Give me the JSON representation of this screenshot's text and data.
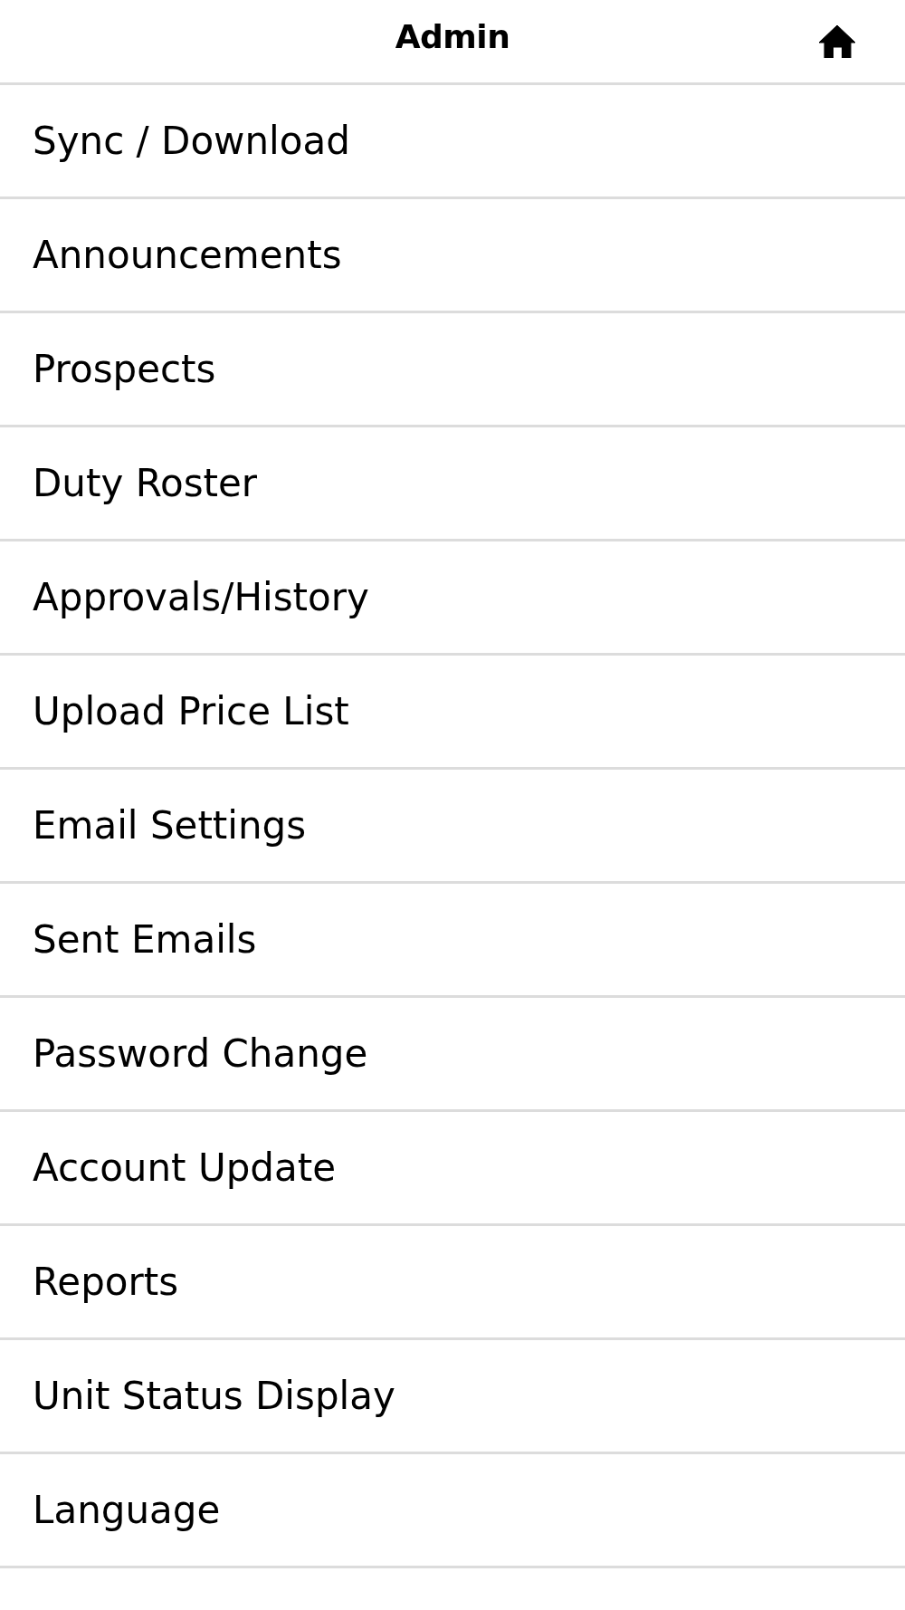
{
  "header": {
    "title": "Admin"
  },
  "menu": {
    "items": [
      {
        "label": "Sync / Download"
      },
      {
        "label": "Announcements"
      },
      {
        "label": "Prospects"
      },
      {
        "label": "Duty Roster"
      },
      {
        "label": "Approvals/History"
      },
      {
        "label": "Upload Price List"
      },
      {
        "label": "Email Settings"
      },
      {
        "label": "Sent Emails"
      },
      {
        "label": "Password Change"
      },
      {
        "label": "Account Update"
      },
      {
        "label": "Reports"
      },
      {
        "label": "Unit Status Display"
      },
      {
        "label": "Language"
      }
    ]
  }
}
